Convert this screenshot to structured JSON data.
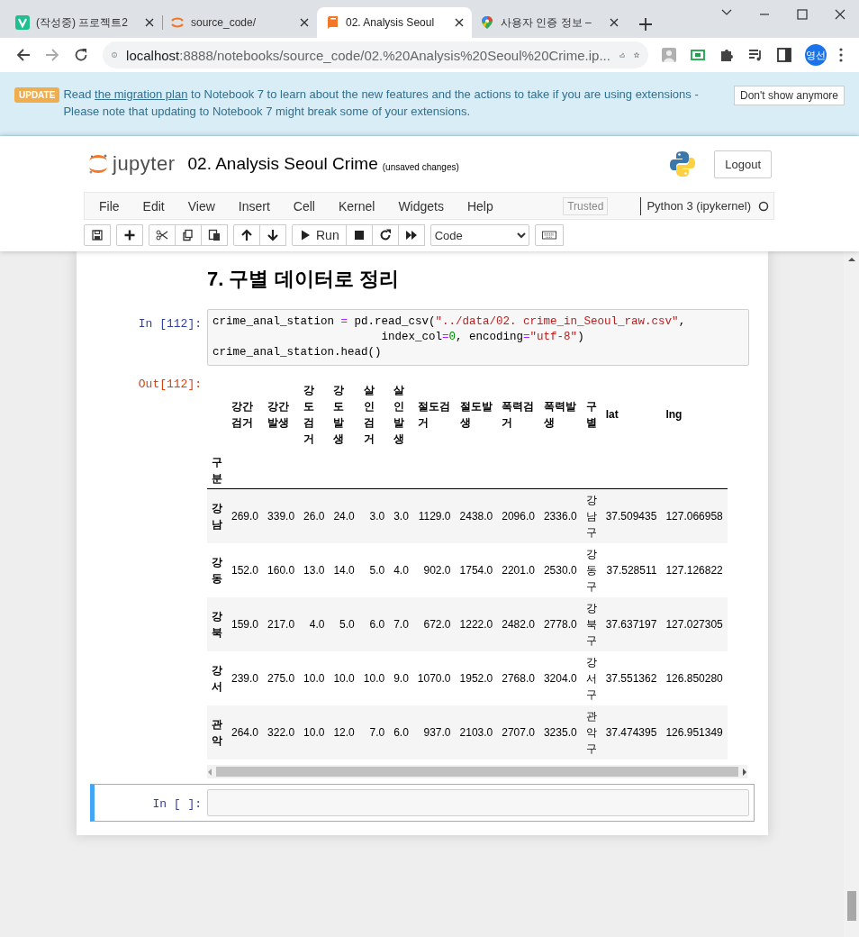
{
  "browser": {
    "tabs": [
      {
        "title": "(작성중) 프로젝트2",
        "selected": false
      },
      {
        "title": "source_code/",
        "selected": false
      },
      {
        "title": "02. Analysis Seoul",
        "selected": true
      },
      {
        "title": "사용자 인증 정보 –",
        "selected": false
      }
    ],
    "address": {
      "host": "localhost",
      "rest": ":8888/notebooks/source_code/02.%20Analysis%20Seoul%20Crime.ip..."
    },
    "profile": "영선"
  },
  "banner": {
    "badge": "UPDATE",
    "before": "Read ",
    "link": "the migration plan",
    "after": " to Notebook 7 to learn about the new features and the actions to take if you are using extensions - Please note that updating to Notebook 7 might break some of your extensions.",
    "button": "Don't show anymore"
  },
  "header": {
    "logo_text": "jupyter",
    "title": "02. Analysis Seoul Crime",
    "save_status": "(unsaved changes)",
    "logout": "Logout"
  },
  "menubar": {
    "items": [
      "File",
      "Edit",
      "View",
      "Insert",
      "Cell",
      "Kernel",
      "Widgets",
      "Help"
    ],
    "trusted": "Trusted",
    "kernel": "Python 3 (ipykernel)",
    "kernel_busy": false
  },
  "toolbar": {
    "groups": [
      [
        {
          "kind": "save"
        }
      ],
      [
        {
          "kind": "insert"
        }
      ],
      [
        {
          "kind": "cut"
        },
        {
          "kind": "copy"
        },
        {
          "kind": "paste"
        }
      ],
      [
        {
          "kind": "up"
        },
        {
          "kind": "down"
        }
      ],
      [
        {
          "kind": "run",
          "label": "Run"
        },
        {
          "kind": "stop"
        },
        {
          "kind": "restart"
        },
        {
          "kind": "run-all"
        }
      ]
    ],
    "cell_type": "Code"
  },
  "cells": [
    {
      "kind": "markdown",
      "heading": "7. 구별 데이터로 정리",
      "selected": false
    },
    {
      "kind": "code",
      "prompt": "In [112]:",
      "selected": false,
      "lines": [
        [
          {
            "t": "crime_anal_station ",
            "kind": "plain"
          },
          {
            "t": "=",
            "kind": "op"
          },
          {
            "t": " pd.read_csv(",
            "kind": "plain"
          },
          {
            "t": "\"../data/02. crime_in_Seoul_raw.csv\"",
            "kind": "str"
          },
          {
            "t": ",",
            "kind": "plain"
          }
        ],
        [
          {
            "t": "                         index_col",
            "kind": "plain"
          },
          {
            "t": "=",
            "kind": "op"
          },
          {
            "t": "0",
            "kind": "num"
          },
          {
            "t": ", encoding",
            "kind": "plain"
          },
          {
            "t": "=",
            "kind": "op"
          },
          {
            "t": "\"utf-8\"",
            "kind": "str"
          },
          {
            "t": ")",
            "kind": "plain"
          }
        ],
        [
          {
            "t": "crime_anal_station.head()",
            "kind": "plain"
          }
        ]
      ],
      "output": {
        "prompt": "Out[112]:",
        "table": {
          "columns": [
            "강간검거",
            "강간발생",
            "강도검거",
            "강도발생",
            "살인검거",
            "살인발생",
            "절도검거",
            "절도발생",
            "폭력검거",
            "폭력발생",
            "구별",
            "lat",
            "lng"
          ],
          "index_name": "구분",
          "rows": [
            {
              "index": "강남",
              "cells": [
                "269.0",
                "339.0",
                "26.0",
                "24.0",
                "3.0",
                "3.0",
                "1129.0",
                "2438.0",
                "2096.0",
                "2336.0",
                "강남구",
                "37.509435",
                "127.066958"
              ]
            },
            {
              "index": "강동",
              "cells": [
                "152.0",
                "160.0",
                "13.0",
                "14.0",
                "5.0",
                "4.0",
                "902.0",
                "1754.0",
                "2201.0",
                "2530.0",
                "강동구",
                "37.528511",
                "127.126822"
              ]
            },
            {
              "index": "강북",
              "cells": [
                "159.0",
                "217.0",
                "4.0",
                "5.0",
                "6.0",
                "7.0",
                "672.0",
                "1222.0",
                "2482.0",
                "2778.0",
                "강북구",
                "37.637197",
                "127.027305"
              ]
            },
            {
              "index": "강서",
              "cells": [
                "239.0",
                "275.0",
                "10.0",
                "10.0",
                "10.0",
                "9.0",
                "1070.0",
                "1952.0",
                "2768.0",
                "3204.0",
                "강서구",
                "37.551362",
                "126.850280"
              ]
            },
            {
              "index": "관악",
              "cells": [
                "264.0",
                "322.0",
                "10.0",
                "12.0",
                "7.0",
                "6.0",
                "937.0",
                "2103.0",
                "2707.0",
                "3235.0",
                "관악구",
                "37.474395",
                "126.951349"
              ]
            }
          ]
        }
      }
    },
    {
      "kind": "code",
      "prompt": "In [ ]:",
      "selected": true
    }
  ]
}
